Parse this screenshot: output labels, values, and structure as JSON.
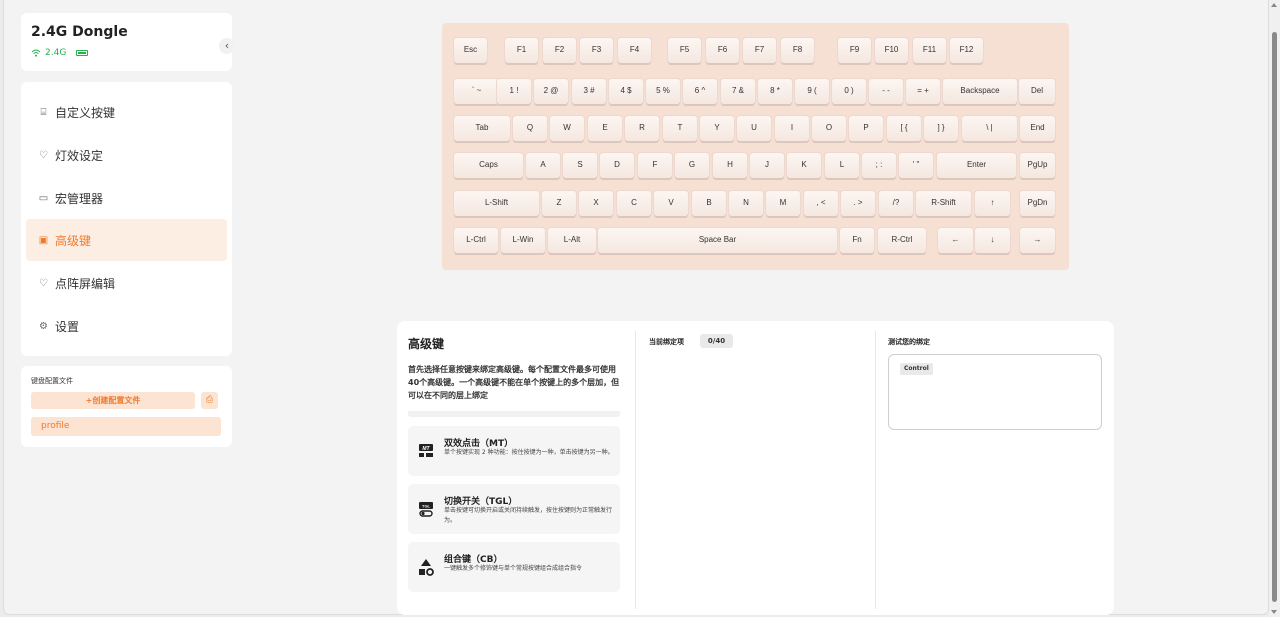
{
  "device": {
    "title": "2.4G Dongle",
    "connection": "2.4G",
    "collapse_glyph": "‹"
  },
  "nav": {
    "items": [
      {
        "label": "自定义按键",
        "icon": "keyboard-icon",
        "glyph": "⌸"
      },
      {
        "label": "灯效设定",
        "icon": "bulb-icon",
        "glyph": "♡"
      },
      {
        "label": "宏管理器",
        "icon": "macro-icon",
        "glyph": "▭"
      },
      {
        "label": "高级键",
        "icon": "advanced-icon",
        "glyph": "▣"
      },
      {
        "label": "点阵屏编辑",
        "icon": "matrix-icon",
        "glyph": "♡"
      },
      {
        "label": "设置",
        "icon": "gear-icon",
        "glyph": "⚙"
      }
    ],
    "active_index": 3
  },
  "profiles": {
    "title": "键盘配置文件",
    "create_label": "+创建配置文件",
    "import_icon": "import-icon",
    "items": [
      "profile"
    ]
  },
  "keyboard": {
    "rows": [
      [
        "Esc",
        "F1",
        "F2",
        "F3",
        "F4",
        "F5",
        "F6",
        "F7",
        "F8",
        "F9",
        "F10",
        "F11",
        "F12"
      ],
      [
        "` ~",
        "1 !",
        "2 @",
        "3 #",
        "4 $",
        "5 %",
        "6 ^",
        "7 &",
        "8 *",
        "9 (",
        "0 )",
        "- -",
        "= +",
        "Backspace",
        "Del"
      ],
      [
        "Tab",
        "Q",
        "W",
        "E",
        "R",
        "T",
        "Y",
        "U",
        "I",
        "O",
        "P",
        "[ {",
        "] }",
        "\\ |",
        "End"
      ],
      [
        "Caps",
        "A",
        "S",
        "D",
        "F",
        "G",
        "H",
        "J",
        "K",
        "L",
        ";  :",
        "' \"",
        "Enter",
        "PgUp"
      ],
      [
        "L-Shift",
        "Z",
        "X",
        "C",
        "V",
        "B",
        "N",
        "M",
        ", <",
        ". >",
        "/?",
        "R-Shift",
        "↑",
        "PgDn"
      ],
      [
        "L-Ctrl",
        "L-Win",
        "L-Alt",
        "Space Bar",
        "Fn",
        "R-Ctrl",
        "←",
        "↓",
        "→"
      ]
    ]
  },
  "panel": {
    "title": "高级键",
    "description": "首先选择任意按键来绑定高级键。每个配置文件最多可使用40个高级键。一个高级键不能在单个按键上的多个层加，但可以在不同的层上绑定",
    "modes": [
      {
        "name": "双效点击（MT）",
        "desc": "单个按键实现 2 种功能：按住按键为一种，单击按键为另一种。",
        "icon": "mt-icon"
      },
      {
        "name": "切换开关（TGL）",
        "desc": "单击按键可切换开启或关闭持续触发，按住按键则为正常触发行为。",
        "icon": "tgl-icon"
      },
      {
        "name": "组合键（CB）",
        "desc": "一键触发多个修饰键与单个常规按键组合成组合指令",
        "icon": "cb-icon"
      }
    ],
    "binding_label": "当前绑定项",
    "binding_count": "0/40",
    "test_label": "测试您的绑定",
    "test_chip": "Control"
  },
  "colors": {
    "accent": "#f07a2e",
    "accent_light": "#fde3d2",
    "status_green": "#22b24c",
    "keyboard_bg": "#f6dfd3"
  }
}
